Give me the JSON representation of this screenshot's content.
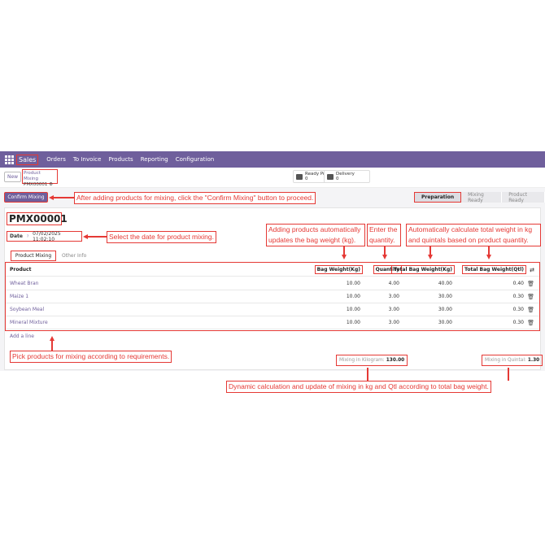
{
  "nav": {
    "brand": "Sales",
    "menu": [
      "Orders",
      "To Invoice",
      "Products",
      "Reporting",
      "Configuration"
    ]
  },
  "control": {
    "new_label": "New",
    "breadcrumb_parent": "Product Mixing",
    "breadcrumb_record": "PMX00001",
    "smart_buttons": [
      {
        "label": "Ready Product",
        "count": "0",
        "icon": "warehouse-icon"
      },
      {
        "label": "Delivery",
        "count": "0",
        "icon": "truck-icon"
      }
    ]
  },
  "actions": {
    "confirm_label": "Confirm Mixing"
  },
  "stages": [
    "Preparation",
    "Mixing Ready",
    "Product Ready"
  ],
  "active_stage": "Preparation",
  "form": {
    "title": "PMX00001",
    "date_label": "Date",
    "date_value": "07/02/2025 11:02:10",
    "tabs": [
      "Product Mixing",
      "Other Info"
    ]
  },
  "table": {
    "headers": [
      "Product",
      "Bag Weight(Kg)",
      "Quantity",
      "Total Bag Weight(Kg)",
      "Total Bag Weight(Qtl)"
    ],
    "rows": [
      {
        "product": "Wheat Bran",
        "bag_weight": "10.00",
        "quantity": "4.00",
        "total_kg": "40.00",
        "total_qtl": "0.40"
      },
      {
        "product": "Maize 1",
        "bag_weight": "10.00",
        "quantity": "3.00",
        "total_kg": "30.00",
        "total_qtl": "0.30"
      },
      {
        "product": "Soybean Meal",
        "bag_weight": "10.00",
        "quantity": "3.00",
        "total_kg": "30.00",
        "total_qtl": "0.30"
      },
      {
        "product": "Mineral Mixture",
        "bag_weight": "10.00",
        "quantity": "3.00",
        "total_kg": "30.00",
        "total_qtl": "0.30"
      }
    ],
    "add_line": "Add a line"
  },
  "totals": {
    "kg_label": "Mixing in Kilogram:",
    "kg_value": "130.00",
    "qtl_label": "Mixing in Quintal:",
    "qtl_value": "1.30"
  },
  "annotations": {
    "confirm": "After adding products for mixing, click the \"Confirm Mixing\" button to proceed.",
    "date": "Select the date for product mixing.",
    "bag_weight": "Adding products automatically updates the bag weight (kg).",
    "quantity": "Enter the quantity.",
    "total_weight": "Automatically calculate total weight in kg and quintals based on product quantity.",
    "products": "Pick products for mixing according to requirements.",
    "dynamic": "Dynamic calculation and update of mixing in kg and Qtl according to total bag weight."
  },
  "colors": {
    "brand": "#6f5f9c",
    "annotation": "#e53935"
  }
}
